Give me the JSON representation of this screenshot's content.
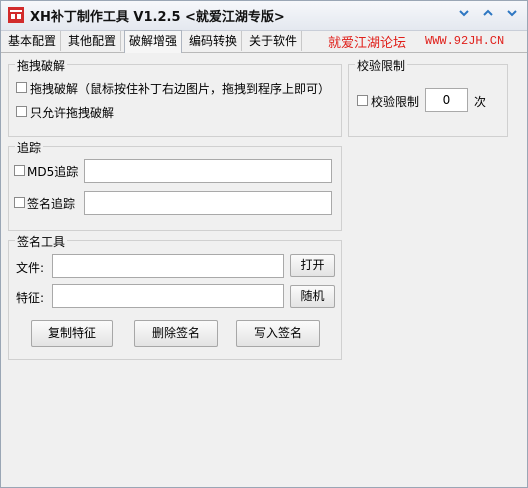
{
  "window": {
    "title": "XH补丁制作工具 V1.2.5  <就爱江湖专版>",
    "minimize_icon": "chevron-down",
    "maximize_icon": "chevron-up",
    "close_icon": "chevron-down"
  },
  "tabs": [
    {
      "label": "基本配置",
      "active": false
    },
    {
      "label": "其他配置",
      "active": false
    },
    {
      "label": "破解增强",
      "active": true
    },
    {
      "label": "编码转换",
      "active": false
    },
    {
      "label": "关于软件",
      "active": false
    }
  ],
  "promo": {
    "site_name": "就爱江湖论坛",
    "url": "WWW.92JH.CN",
    "color": "#e0201b"
  },
  "drag_crack": {
    "title": "拖拽破解",
    "drag_label": "拖拽破解（鼠标按住补丁右边图片，拖拽到程序上即可）",
    "only_drag_label": "只允许拖拽破解"
  },
  "check_limit": {
    "title": "校验限制",
    "label": "校验限制",
    "value": "0",
    "unit": "次"
  },
  "tracking": {
    "title": "追踪",
    "md5_label": "MD5追踪",
    "md5_value": "",
    "sig_label": "签名追踪",
    "sig_value": ""
  },
  "signature_tool": {
    "title": "签名工具",
    "file_label": "文件:",
    "file_value": "",
    "open_button": "打开",
    "feature_label": "特征:",
    "feature_value": "",
    "random_button": "随机",
    "copy_button": "复制特征",
    "delete_button": "删除签名",
    "write_button": "写入签名"
  }
}
